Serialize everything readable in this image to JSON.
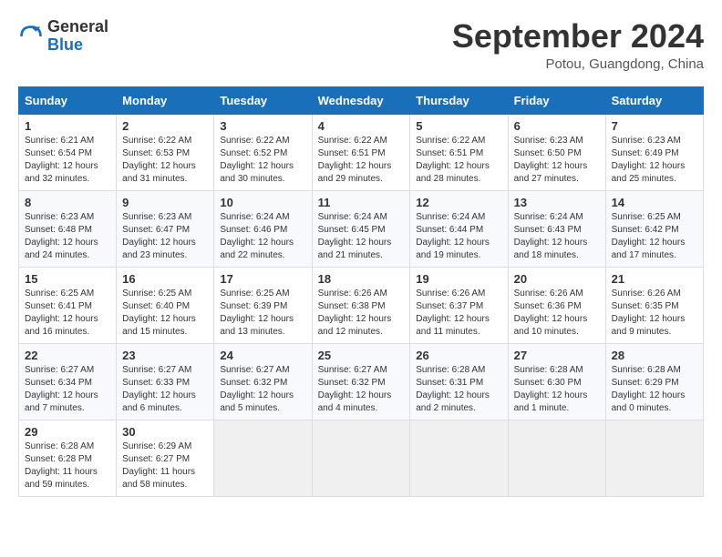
{
  "header": {
    "logo_general": "General",
    "logo_blue": "Blue",
    "month_title": "September 2024",
    "location": "Potou, Guangdong, China"
  },
  "days_of_week": [
    "Sunday",
    "Monday",
    "Tuesday",
    "Wednesday",
    "Thursday",
    "Friday",
    "Saturday"
  ],
  "weeks": [
    [
      {
        "day": "1",
        "sunrise": "Sunrise: 6:21 AM",
        "sunset": "Sunset: 6:54 PM",
        "daylight": "Daylight: 12 hours and 32 minutes."
      },
      {
        "day": "2",
        "sunrise": "Sunrise: 6:22 AM",
        "sunset": "Sunset: 6:53 PM",
        "daylight": "Daylight: 12 hours and 31 minutes."
      },
      {
        "day": "3",
        "sunrise": "Sunrise: 6:22 AM",
        "sunset": "Sunset: 6:52 PM",
        "daylight": "Daylight: 12 hours and 30 minutes."
      },
      {
        "day": "4",
        "sunrise": "Sunrise: 6:22 AM",
        "sunset": "Sunset: 6:51 PM",
        "daylight": "Daylight: 12 hours and 29 minutes."
      },
      {
        "day": "5",
        "sunrise": "Sunrise: 6:22 AM",
        "sunset": "Sunset: 6:51 PM",
        "daylight": "Daylight: 12 hours and 28 minutes."
      },
      {
        "day": "6",
        "sunrise": "Sunrise: 6:23 AM",
        "sunset": "Sunset: 6:50 PM",
        "daylight": "Daylight: 12 hours and 27 minutes."
      },
      {
        "day": "7",
        "sunrise": "Sunrise: 6:23 AM",
        "sunset": "Sunset: 6:49 PM",
        "daylight": "Daylight: 12 hours and 25 minutes."
      }
    ],
    [
      {
        "day": "8",
        "sunrise": "Sunrise: 6:23 AM",
        "sunset": "Sunset: 6:48 PM",
        "daylight": "Daylight: 12 hours and 24 minutes."
      },
      {
        "day": "9",
        "sunrise": "Sunrise: 6:23 AM",
        "sunset": "Sunset: 6:47 PM",
        "daylight": "Daylight: 12 hours and 23 minutes."
      },
      {
        "day": "10",
        "sunrise": "Sunrise: 6:24 AM",
        "sunset": "Sunset: 6:46 PM",
        "daylight": "Daylight: 12 hours and 22 minutes."
      },
      {
        "day": "11",
        "sunrise": "Sunrise: 6:24 AM",
        "sunset": "Sunset: 6:45 PM",
        "daylight": "Daylight: 12 hours and 21 minutes."
      },
      {
        "day": "12",
        "sunrise": "Sunrise: 6:24 AM",
        "sunset": "Sunset: 6:44 PM",
        "daylight": "Daylight: 12 hours and 19 minutes."
      },
      {
        "day": "13",
        "sunrise": "Sunrise: 6:24 AM",
        "sunset": "Sunset: 6:43 PM",
        "daylight": "Daylight: 12 hours and 18 minutes."
      },
      {
        "day": "14",
        "sunrise": "Sunrise: 6:25 AM",
        "sunset": "Sunset: 6:42 PM",
        "daylight": "Daylight: 12 hours and 17 minutes."
      }
    ],
    [
      {
        "day": "15",
        "sunrise": "Sunrise: 6:25 AM",
        "sunset": "Sunset: 6:41 PM",
        "daylight": "Daylight: 12 hours and 16 minutes."
      },
      {
        "day": "16",
        "sunrise": "Sunrise: 6:25 AM",
        "sunset": "Sunset: 6:40 PM",
        "daylight": "Daylight: 12 hours and 15 minutes."
      },
      {
        "day": "17",
        "sunrise": "Sunrise: 6:25 AM",
        "sunset": "Sunset: 6:39 PM",
        "daylight": "Daylight: 12 hours and 13 minutes."
      },
      {
        "day": "18",
        "sunrise": "Sunrise: 6:26 AM",
        "sunset": "Sunset: 6:38 PM",
        "daylight": "Daylight: 12 hours and 12 minutes."
      },
      {
        "day": "19",
        "sunrise": "Sunrise: 6:26 AM",
        "sunset": "Sunset: 6:37 PM",
        "daylight": "Daylight: 12 hours and 11 minutes."
      },
      {
        "day": "20",
        "sunrise": "Sunrise: 6:26 AM",
        "sunset": "Sunset: 6:36 PM",
        "daylight": "Daylight: 12 hours and 10 minutes."
      },
      {
        "day": "21",
        "sunrise": "Sunrise: 6:26 AM",
        "sunset": "Sunset: 6:35 PM",
        "daylight": "Daylight: 12 hours and 9 minutes."
      }
    ],
    [
      {
        "day": "22",
        "sunrise": "Sunrise: 6:27 AM",
        "sunset": "Sunset: 6:34 PM",
        "daylight": "Daylight: 12 hours and 7 minutes."
      },
      {
        "day": "23",
        "sunrise": "Sunrise: 6:27 AM",
        "sunset": "Sunset: 6:33 PM",
        "daylight": "Daylight: 12 hours and 6 minutes."
      },
      {
        "day": "24",
        "sunrise": "Sunrise: 6:27 AM",
        "sunset": "Sunset: 6:32 PM",
        "daylight": "Daylight: 12 hours and 5 minutes."
      },
      {
        "day": "25",
        "sunrise": "Sunrise: 6:27 AM",
        "sunset": "Sunset: 6:32 PM",
        "daylight": "Daylight: 12 hours and 4 minutes."
      },
      {
        "day": "26",
        "sunrise": "Sunrise: 6:28 AM",
        "sunset": "Sunset: 6:31 PM",
        "daylight": "Daylight: 12 hours and 2 minutes."
      },
      {
        "day": "27",
        "sunrise": "Sunrise: 6:28 AM",
        "sunset": "Sunset: 6:30 PM",
        "daylight": "Daylight: 12 hours and 1 minute."
      },
      {
        "day": "28",
        "sunrise": "Sunrise: 6:28 AM",
        "sunset": "Sunset: 6:29 PM",
        "daylight": "Daylight: 12 hours and 0 minutes."
      }
    ],
    [
      {
        "day": "29",
        "sunrise": "Sunrise: 6:28 AM",
        "sunset": "Sunset: 6:28 PM",
        "daylight": "Daylight: 11 hours and 59 minutes."
      },
      {
        "day": "30",
        "sunrise": "Sunrise: 6:29 AM",
        "sunset": "Sunset: 6:27 PM",
        "daylight": "Daylight: 11 hours and 58 minutes."
      },
      null,
      null,
      null,
      null,
      null
    ]
  ]
}
